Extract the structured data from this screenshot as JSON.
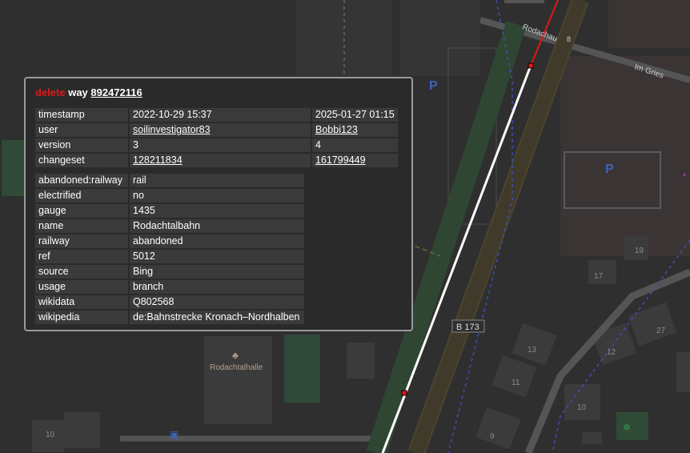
{
  "map": {
    "labels": {
      "street1": "Rodachau",
      "street2": "Im Gries",
      "road": "B 173",
      "hall": "Rodachtalhalle",
      "parking": "P",
      "bus": "8"
    },
    "house_numbers": [
      "19",
      "17",
      "13",
      "12",
      "27",
      "11",
      "10",
      "10",
      "9"
    ],
    "colors": {
      "background": "#2f2f2f",
      "selected_way": "#ffffff",
      "deleted_way": "#e01818",
      "road": "#3f3a2a"
    }
  },
  "popup": {
    "action": "delete",
    "entity_type": "way",
    "entity_id": "892472116",
    "meta": [
      {
        "key": "timestamp",
        "old": "2022-10-29 15:37",
        "new": "2025-01-27 01:15",
        "link": false
      },
      {
        "key": "user",
        "old": "soilinvestigator83",
        "new": "Bobbi123",
        "link": true
      },
      {
        "key": "version",
        "old": "3",
        "new": "4",
        "link": false
      },
      {
        "key": "changeset",
        "old": "128211834",
        "new": "161799449",
        "link": true
      }
    ],
    "tags": [
      {
        "key": "abandoned:railway",
        "value": "rail"
      },
      {
        "key": "electrified",
        "value": "no"
      },
      {
        "key": "gauge",
        "value": "1435"
      },
      {
        "key": "name",
        "value": "Rodachtalbahn"
      },
      {
        "key": "railway",
        "value": "abandoned"
      },
      {
        "key": "ref",
        "value": "5012"
      },
      {
        "key": "source",
        "value": "Bing"
      },
      {
        "key": "usage",
        "value": "branch"
      },
      {
        "key": "wikidata",
        "value": "Q802568"
      },
      {
        "key": "wikipedia",
        "value": "de:Bahnstrecke Kronach–Nordhalben"
      }
    ]
  }
}
